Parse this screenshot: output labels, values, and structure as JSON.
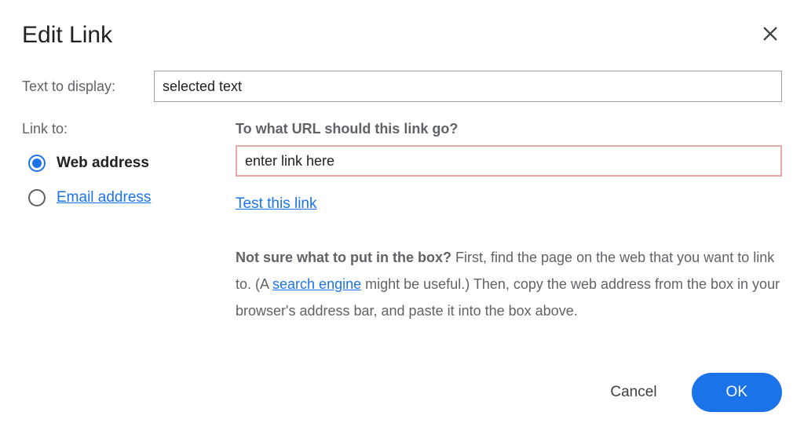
{
  "dialog": {
    "title": "Edit Link",
    "text_display_label": "Text to display:",
    "text_display_value": "selected text",
    "link_to_label": "Link to:",
    "radio": {
      "web": "Web address",
      "email": "Email address"
    },
    "url_prompt": "To what URL should this link go?",
    "url_value": "enter link here",
    "test_link": "Test this link",
    "help": {
      "bold": "Not sure what to put in the box?",
      "part1": " First, find the page on the web that you want to link to. (A ",
      "search_link": "search engine",
      "part2": " might be useful.) Then, copy the web address from the box in your browser's address bar, and paste it into the box above."
    },
    "cancel": "Cancel",
    "ok": "OK"
  }
}
